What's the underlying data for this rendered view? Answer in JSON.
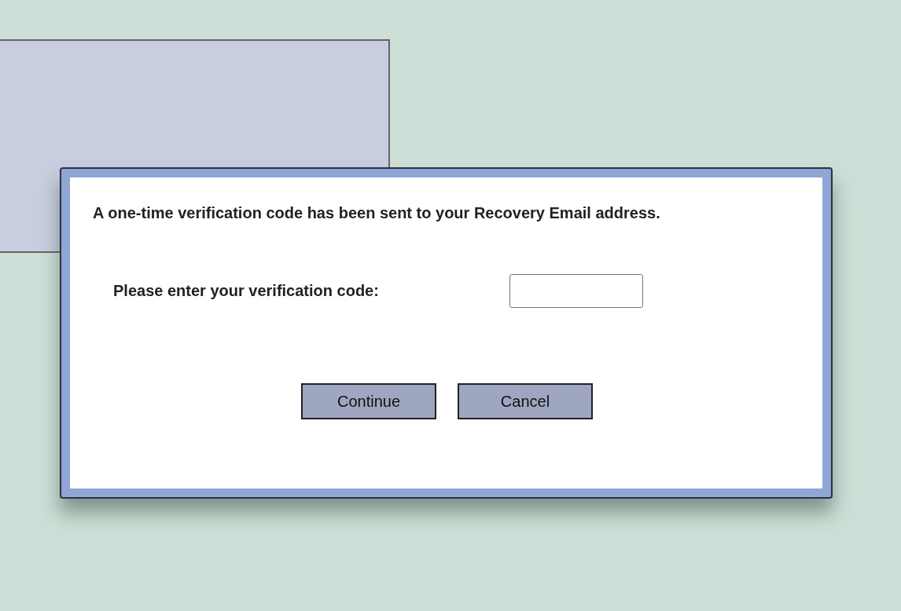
{
  "dialog": {
    "message": "A one-time verification code has been sent to your Recovery Email address.",
    "prompt": "Please enter your verification code:",
    "buttons": [
      "Continue",
      "Cancel"
    ]
  }
}
